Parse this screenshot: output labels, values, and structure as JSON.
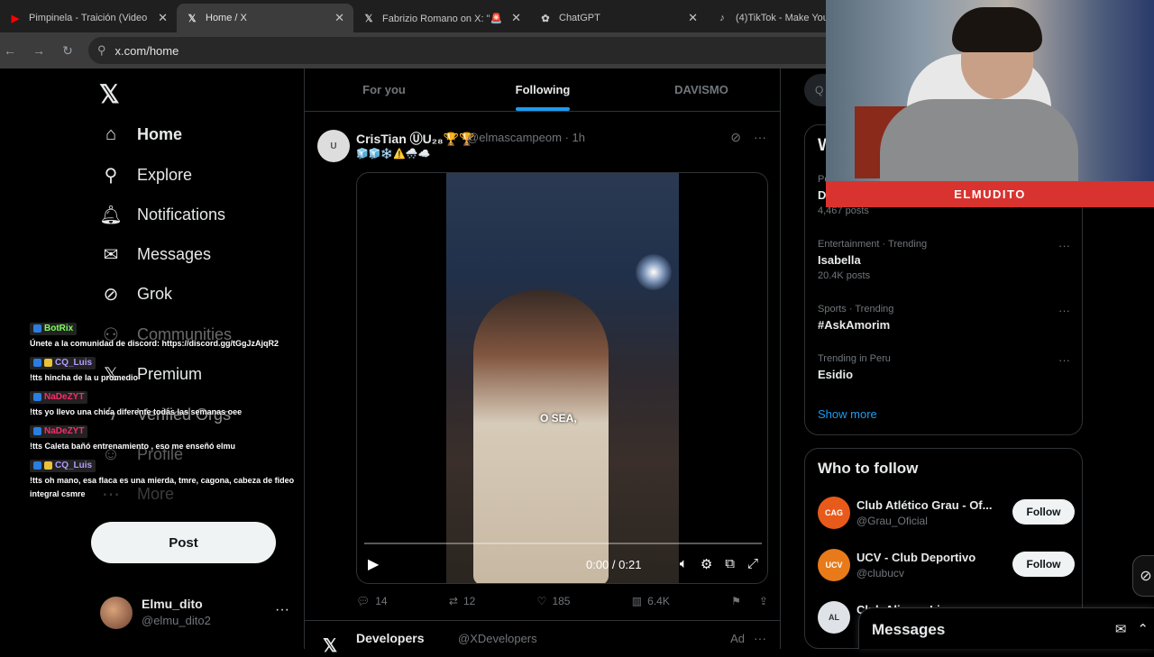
{
  "browser": {
    "tabs": [
      {
        "title": "Pimpinela - Traición (Video",
        "icon": "youtube-icon",
        "color": "#ff0000"
      },
      {
        "title": "Home / X",
        "icon": "x-icon",
        "color": "#e7e9ea"
      },
      {
        "title": "Fabrizio Romano on X: \"🚨",
        "icon": "x-icon",
        "color": "#e7e9ea"
      },
      {
        "title": "ChatGPT",
        "icon": "chatgpt-icon",
        "color": "#e7e9ea"
      },
      {
        "title": "(4)TikTok - Make Your Day",
        "icon": "tiktok-icon",
        "color": "#e7e9ea"
      }
    ],
    "url": "x.com/home"
  },
  "sidebar": {
    "logo": "𝕏",
    "items": [
      {
        "label": "Home",
        "icon": "home-icon"
      },
      {
        "label": "Explore",
        "icon": "search-icon"
      },
      {
        "label": "Notifications",
        "icon": "bell-icon"
      },
      {
        "label": "Messages",
        "icon": "mail-icon"
      },
      {
        "label": "Grok",
        "icon": "grok-icon"
      },
      {
        "label": "Communities",
        "icon": "communities-icon"
      },
      {
        "label": "Premium",
        "icon": "x-premium-icon"
      },
      {
        "label": "Verified Orgs",
        "icon": "lightning-icon"
      },
      {
        "label": "Profile",
        "icon": "person-icon"
      },
      {
        "label": "More",
        "icon": "more-circle-icon"
      }
    ],
    "post_label": "Post",
    "profile": {
      "name": "Elmu_dito",
      "handle": "@elmu_dito2",
      "more": "···"
    }
  },
  "chat": [
    {
      "user": "BotRix",
      "color": "#7cff5a",
      "text": "Únete a la comunidad de discord: https://discord.gg/tGgJzAjqR2"
    },
    {
      "user": "CQ_Luis",
      "color": "#b39cff",
      "text": "!tts hincha de la u promedio"
    },
    {
      "user": "NaDeZYT",
      "color": "#ff2a6a",
      "text": "!tts yo llevo una chica diferente todas las semanas oee"
    },
    {
      "user": "NaDeZYT",
      "color": "#ff2a6a",
      "text": "!tts Caleta bañó entrenamiento , eso me enseñó elmu"
    },
    {
      "user": "CQ_Luis",
      "color": "#b39cff",
      "text": "!tts oh mano, esa flaca es una mierda, tmre, cagona, cabeza de fideo integral csmre"
    }
  ],
  "feed": {
    "tabs": [
      "For you",
      "Following",
      "DAVISMO"
    ],
    "active_tab": 1,
    "tweet": {
      "name": "CrisTian ⓊU₂₈🏆🏆",
      "handle": "@elmascampeom · 1h",
      "emoji_line": "🧊🧊❄️⚠️🌨️☁️",
      "avatar_text": "U",
      "video": {
        "caption": "O SEA,",
        "time": "0:00 / 0:21",
        "progress": 0.0
      },
      "replies": "14",
      "reposts": "12",
      "likes": "185",
      "views": "6.4K"
    },
    "tweet2": {
      "name": "Developers",
      "handle": "@XDevelopers",
      "ad": "Ad",
      "more": "···"
    }
  },
  "right": {
    "search_placeholder": "Q",
    "trends_title": "W",
    "trends": [
      {
        "context": "Po",
        "name": "D",
        "count": "4,467 posts"
      },
      {
        "context": "Entertainment · Trending",
        "name": "Isabella",
        "count": "20.4K posts"
      },
      {
        "context": "Sports · Trending",
        "name": "#AskAmorim",
        "count": ""
      },
      {
        "context": "Trending in Peru",
        "name": "Esidio",
        "count": ""
      }
    ],
    "show_more": "Show more",
    "wtf_title": "Who to follow",
    "accounts": [
      {
        "name": "Club Atlético Grau - Of...",
        "handle": "@Grau_Oficial",
        "follow": "Follow",
        "avatar_color": "#e85a1a",
        "avatar_text": "CAG"
      },
      {
        "name": "UCV - Club Deportivo",
        "handle": "@clubucv",
        "follow": "Follow",
        "avatar_color": "#e87a1a",
        "avatar_text": "UCV"
      },
      {
        "name": "Club Alianza Lima",
        "handle": "",
        "follow": "",
        "avatar_color": "#dfe3e8",
        "avatar_text": "AL"
      }
    ]
  },
  "messages": {
    "title": "Messages"
  },
  "webcam": {
    "banner": "ELMUDITO"
  }
}
